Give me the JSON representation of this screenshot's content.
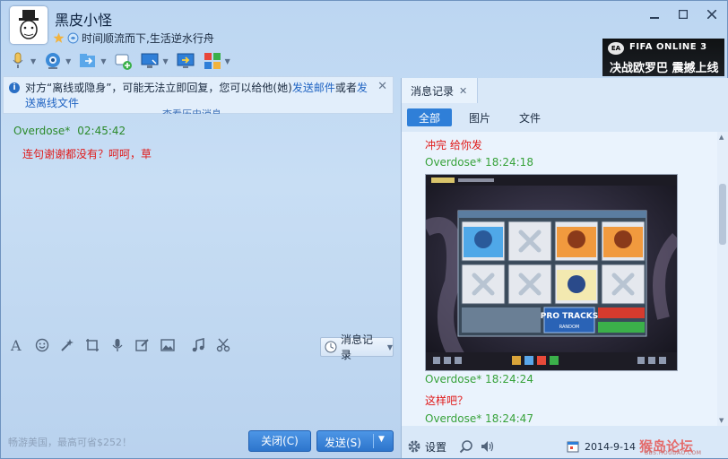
{
  "header": {
    "nickname": "黑皮小怪",
    "signature": "时间顺流而下,生活逆水行舟"
  },
  "ad": {
    "line1": "FIFA ONLINE 3",
    "line2": "决战欧罗巴 震撼上线"
  },
  "toolbar_icons": [
    "microphone-icon",
    "camera-icon",
    "file-transfer-icon",
    "add-chat-icon",
    "remote-desktop-icon",
    "share-screen-icon",
    "apps-icon"
  ],
  "notice": {
    "text_prefix": "对方“离线或隐身”，可能无法立即回复，您可以给他(她)",
    "link1": "发送邮件",
    "text_mid": "或者",
    "link2": "发送离线文件"
  },
  "history_link": "查看历史消息",
  "chat": {
    "sender": "Overdose*",
    "time": "02:45:42",
    "message": "连句谢谢都没有？呵呵，草"
  },
  "input_toolbar_icons": [
    "font-icon",
    "emoji-icon",
    "magic-icon",
    "screenshot-icon",
    "voice-icon",
    "edit-icon",
    "image-icon",
    "music-icon",
    "scissors-icon"
  ],
  "history_button": "消息记录",
  "footer_note": "畅游美国，最高可省$252！",
  "buttons": {
    "close": "关闭(C)",
    "send": "发送(S)"
  },
  "right_panel": {
    "tab_label": "消息记录",
    "filters": [
      "全部",
      "图片",
      "文件"
    ],
    "active_filter": "全部",
    "records": [
      {
        "text": "冲完 给你发",
        "color": "red"
      },
      {
        "text": "Overdose* 18:24:18",
        "color": "green"
      },
      {
        "text": "Overdose* 18:24:24",
        "color": "green"
      },
      {
        "text": "这样吧？",
        "color": "red"
      },
      {
        "text": "Overdose* 18:24:47",
        "color": "green"
      }
    ],
    "game_screenshot": {
      "pro_tracks": "PRO TRACKS",
      "random": "RANDOM"
    },
    "footer": {
      "settings_label": "设置",
      "date": "2014-9-14"
    }
  },
  "watermark": {
    "text": "猴岛论坛",
    "sub": "BBS.HOUDAO.COM"
  }
}
